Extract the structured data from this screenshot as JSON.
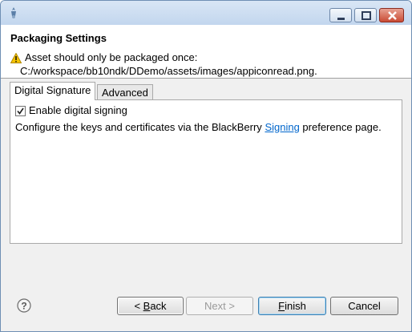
{
  "window": {
    "controls": [
      "minimize-icon",
      "maximize-icon",
      "close-icon"
    ]
  },
  "header": {
    "title": "Packaging Settings",
    "message_line1": "Asset should only be packaged once:",
    "message_line2": "C:/workspace/bb10ndk/DDemo/assets/images/appiconread.png.",
    "message_icon": "warning-icon"
  },
  "tabs": [
    {
      "label": "Digital Signature",
      "selected": true
    },
    {
      "label": "Advanced",
      "selected": false
    }
  ],
  "panel": {
    "checkbox_label": "Enable digital signing",
    "checkbox_checked": true,
    "desc_before": "Configure the keys and certificates via the BlackBerry ",
    "desc_link": "Signing",
    "desc_after": " preference page."
  },
  "footer": {
    "help_icon": "help-icon",
    "back_prefix": "< ",
    "back_mnemonic": "B",
    "back_rest": "ack",
    "next_label": "Next >",
    "finish_mnemonic": "F",
    "finish_rest": "inish",
    "cancel_label": "Cancel"
  },
  "colors": {
    "link": "#0066cc",
    "close_button": "#c94b34",
    "default_button_border": "#3c7fb1"
  }
}
